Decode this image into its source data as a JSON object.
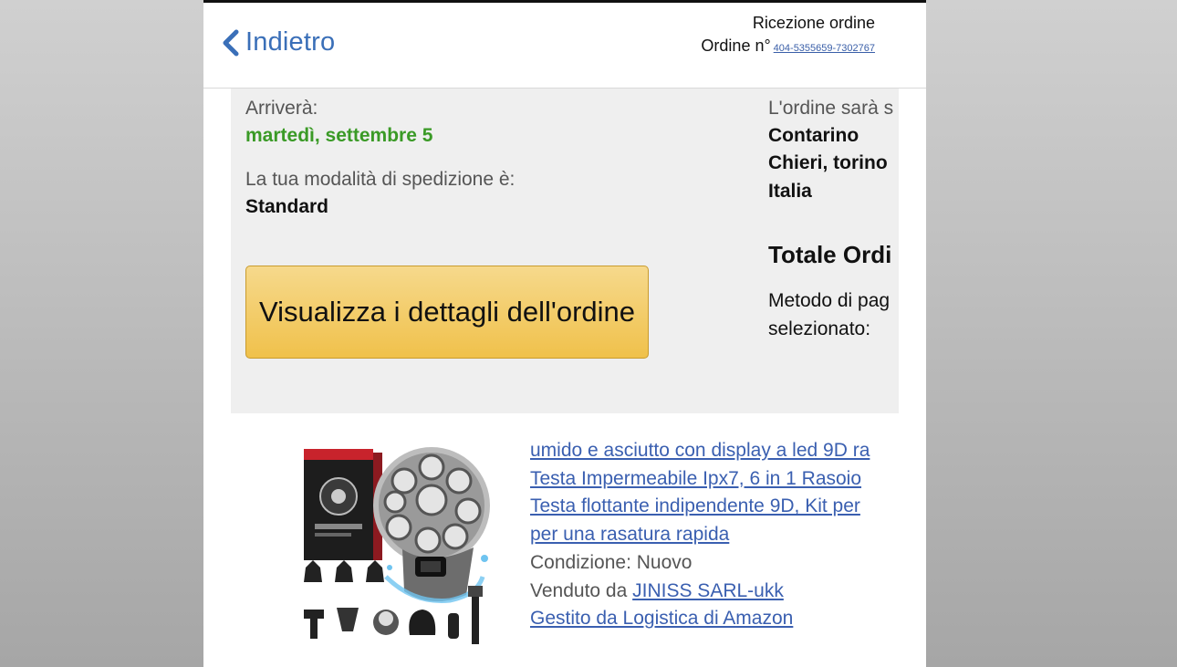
{
  "header": {
    "back_label": "Indietro",
    "title": "Ricezione ordine",
    "order_label": "Ordine n°",
    "order_number": "404-5355659-7302767"
  },
  "summary": {
    "arrival_label": "Arriverà:",
    "arrival_date": "martedì, settembre 5",
    "shipping_label": "La tua modalità di spedizione è:",
    "shipping_method": "Standard",
    "details_button": "Visualizza i dettagli dell'ordine",
    "ship_to_label": "L'ordine sarà s",
    "address": [
      "Contarino",
      "Chieri, torino",
      "Italia"
    ],
    "total_label": "Totale Ordi",
    "payment_label": [
      "Metodo di pag",
      "selezionato:"
    ]
  },
  "product": {
    "image": "shaver-kit-product-image",
    "title_lines": [
      "umido e asciutto con display a led 9D ra",
      "Testa Impermeabile Ipx7, 6 in 1 Rasoio",
      "Testa flottante indipendente 9D, Kit per",
      "per una rasatura rapida "
    ],
    "condition": "Condizione: Nuovo",
    "sold_by_prefix": "Venduto da",
    "seller": "JINISS SARL-ukk",
    "fulfilled_by": "Gestito da Logistica di Amazon"
  },
  "colors": {
    "link": "#3a5fb0",
    "delivery_date": "#3a9a26",
    "button": "#f0c14b",
    "button_border": "#c89b2e",
    "panel": "#efefef"
  },
  "icons": {
    "back": "chevron-left-icon"
  }
}
